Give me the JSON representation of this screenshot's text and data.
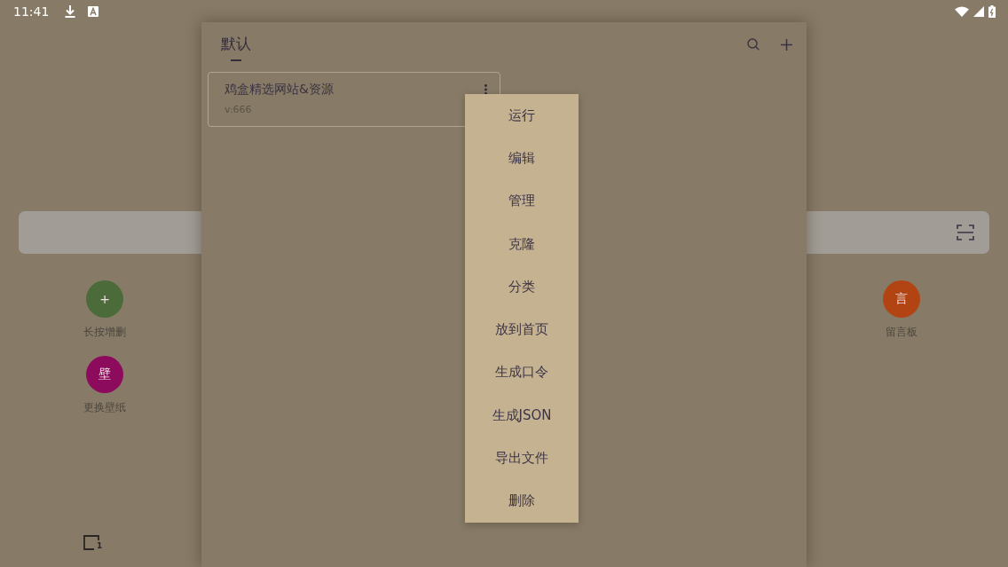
{
  "status_bar": {
    "time": "11:41"
  },
  "left_shortcuts": [
    {
      "glyph": "+",
      "label": "长按增删",
      "color": "#4b6b3b"
    },
    {
      "glyph": "壁",
      "label": "更换壁纸",
      "color": "#8d0b5d"
    }
  ],
  "right_shortcuts": [
    {
      "glyph": "言",
      "label": "留言板",
      "color": "#b24413"
    }
  ],
  "bottom_bar": {
    "tab_count": "1"
  },
  "panel": {
    "tabs": [
      {
        "label": "默认",
        "selected": true
      }
    ],
    "cards": [
      {
        "title": "鸡盒精选网站&资源",
        "version": "v:666"
      }
    ]
  },
  "context_menu": {
    "items": [
      "运行",
      "编辑",
      "管理",
      "克隆",
      "分类",
      "放到首页",
      "生成口令",
      "生成JSON",
      "导出文件",
      "删除"
    ]
  }
}
